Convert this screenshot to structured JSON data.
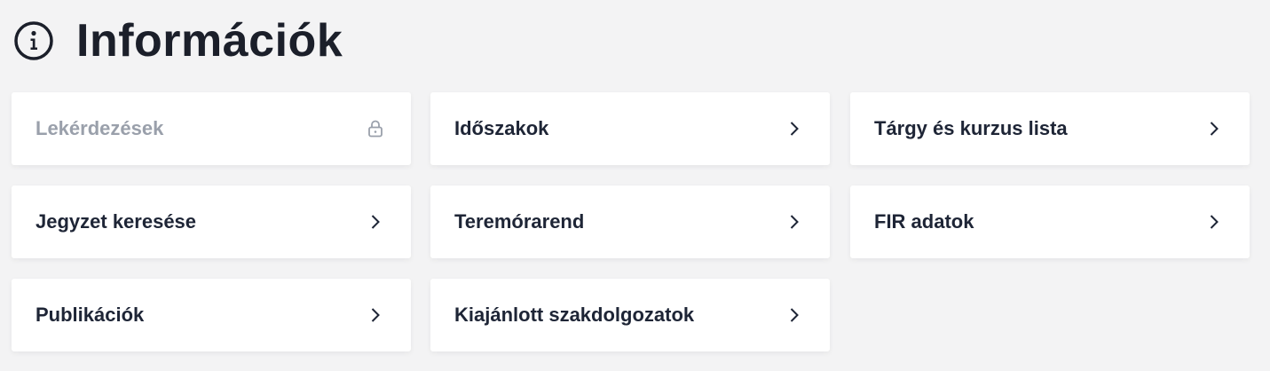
{
  "header": {
    "title": "Információk",
    "icon": "info-circle-icon"
  },
  "colors": {
    "background": "#f3f3f4",
    "card": "#ffffff",
    "text": "#1e2536",
    "disabled_text": "#9aa0ab"
  },
  "cards": [
    {
      "label": "Lekérdezések",
      "icon": "lock-icon",
      "disabled": true
    },
    {
      "label": "Időszakok",
      "icon": "chevron-right-icon",
      "disabled": false
    },
    {
      "label": "Tárgy és kurzus lista",
      "icon": "chevron-right-icon",
      "disabled": false
    },
    {
      "label": "Jegyzet keresése",
      "icon": "chevron-right-icon",
      "disabled": false
    },
    {
      "label": "Teremórarend",
      "icon": "chevron-right-icon",
      "disabled": false
    },
    {
      "label": "FIR adatok",
      "icon": "chevron-right-icon",
      "disabled": false
    },
    {
      "label": "Publikációk",
      "icon": "chevron-right-icon",
      "disabled": false
    },
    {
      "label": "Kiajánlott szakdolgozatok",
      "icon": "chevron-right-icon",
      "disabled": false
    }
  ]
}
